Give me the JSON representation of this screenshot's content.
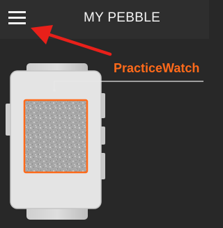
{
  "header": {
    "title": "MY PEBBLE",
    "menu_icon": "hamburger-menu-icon"
  },
  "device": {
    "name": "PracticeWatch",
    "accent_color": "#ff6a1a"
  },
  "annotation": {
    "arrow_color": "#e8201a",
    "target": "hamburger-menu-icon"
  }
}
